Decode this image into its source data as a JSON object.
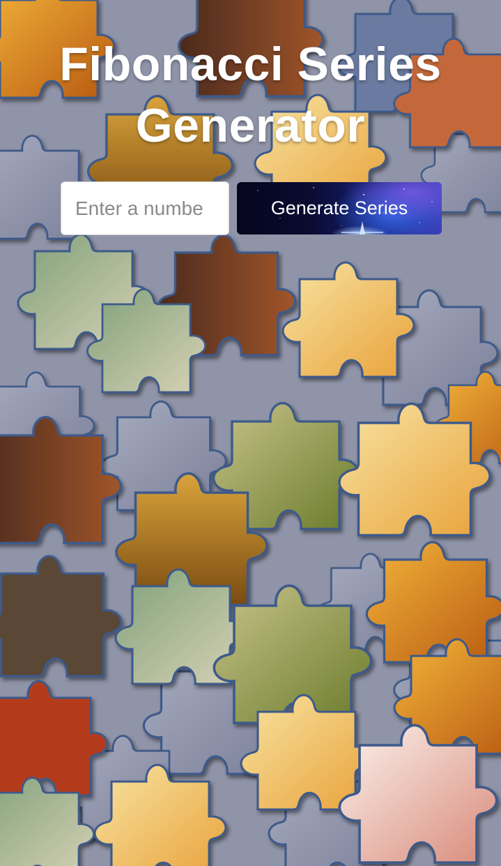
{
  "app": {
    "title": "Fibonacci Series Generator"
  },
  "form": {
    "input_placeholder": "Enter a number",
    "input_value": "",
    "button_label": "Generate Series"
  },
  "colors": {
    "title_text": "#ffffff",
    "button_dark": "#05051c",
    "button_light": "#3b3fb8",
    "input_bg": "#ffffff"
  },
  "background": {
    "description_icon": "jigsaw-puzzle-pieces-photo"
  }
}
